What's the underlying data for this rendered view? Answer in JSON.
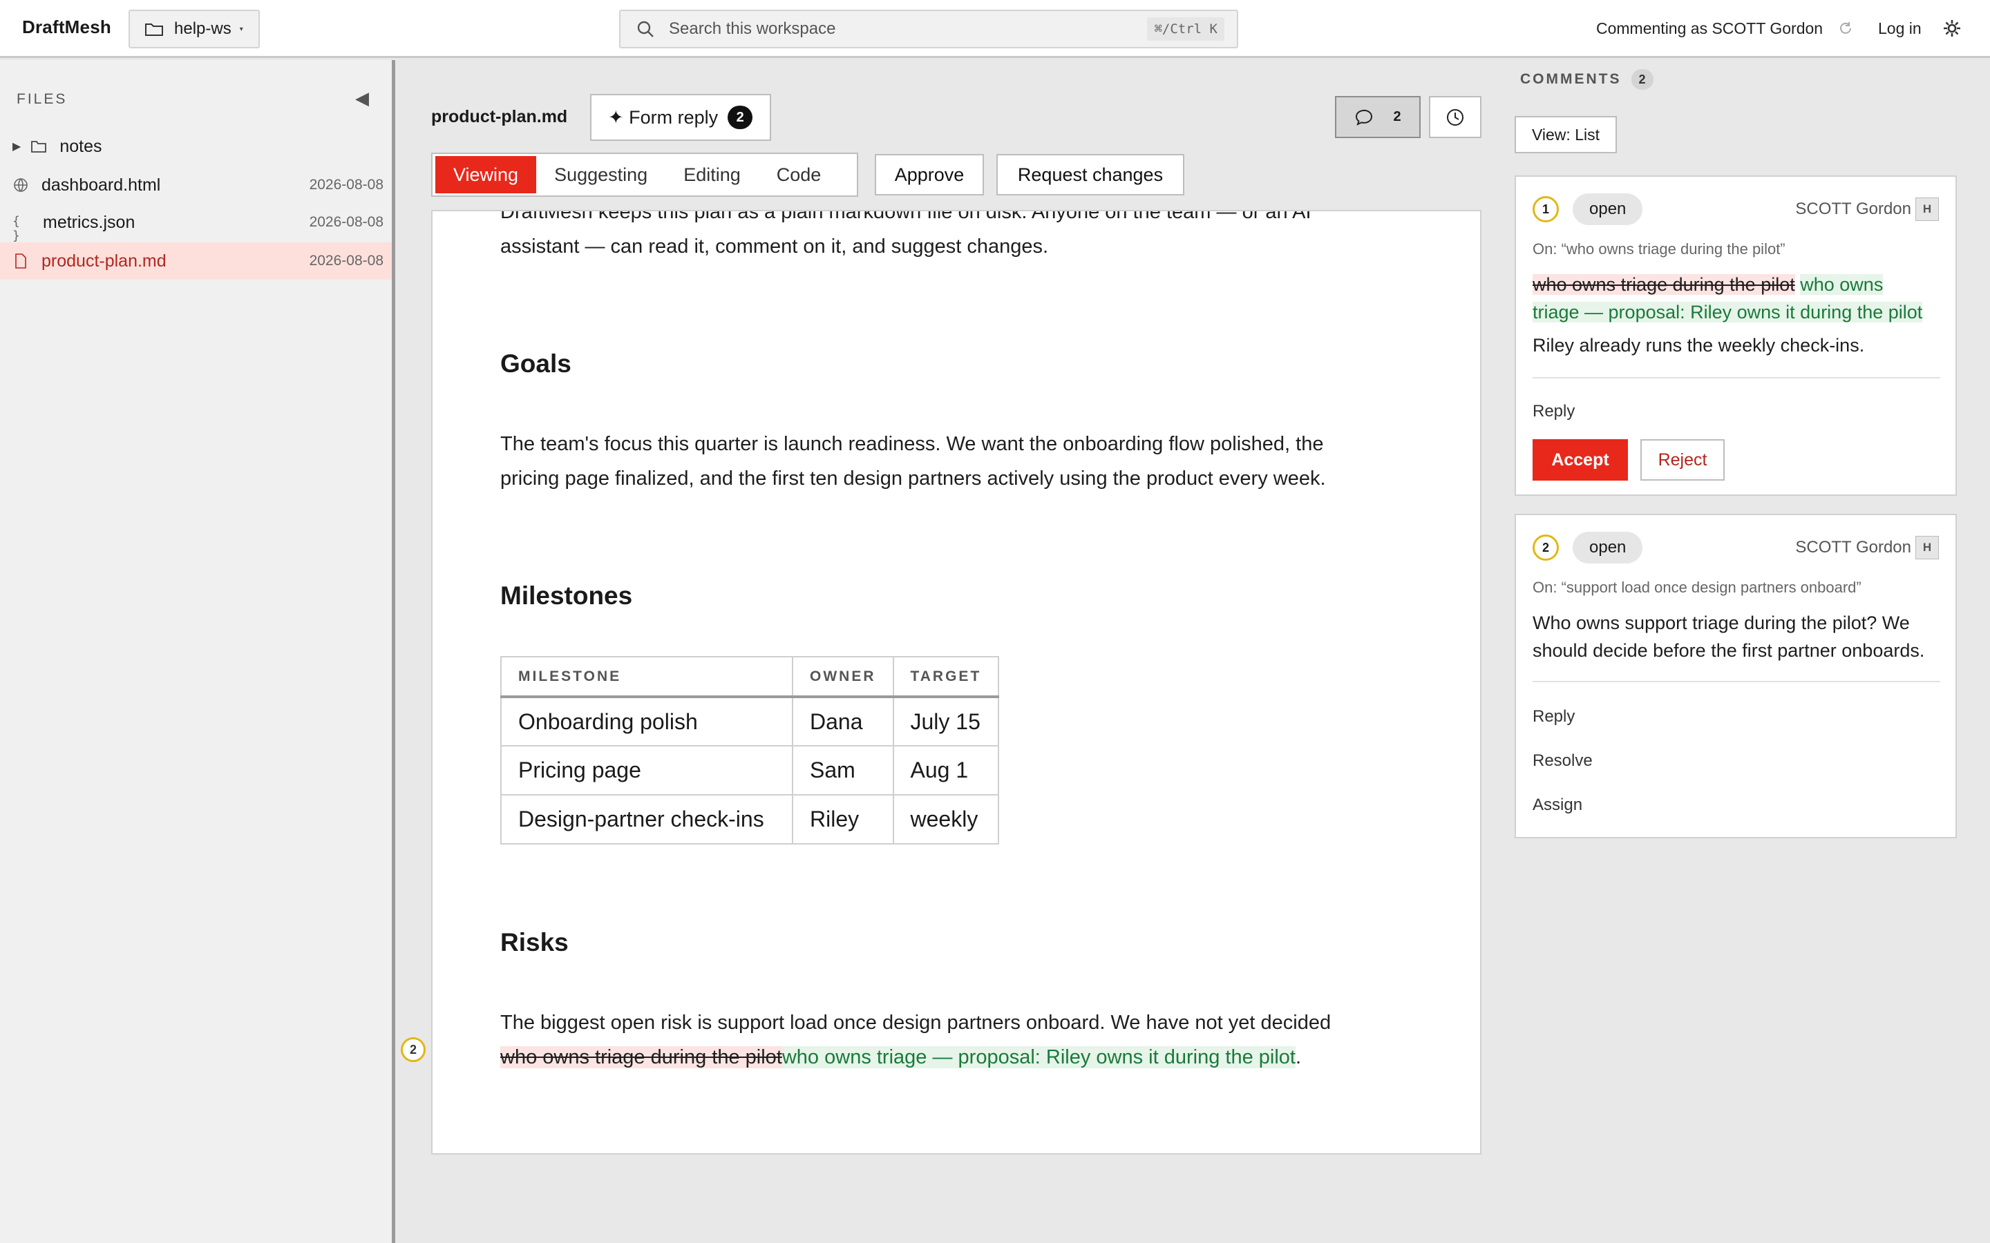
{
  "app": {
    "brand": "DraftMesh"
  },
  "workspace": {
    "name": "help-ws",
    "caret": "▾"
  },
  "search": {
    "placeholder": "Search this workspace",
    "shortcut": "⌘/Ctrl K"
  },
  "header": {
    "commenting_as": "Commenting as SCOTT Gordon",
    "login": "Log in"
  },
  "sidebar": {
    "label": "FILES",
    "collapse_glyph": "◀",
    "folder": {
      "name": "notes"
    },
    "files": [
      {
        "name": "dashboard.html",
        "date": "2026-08-08",
        "icon": "globe-icon"
      },
      {
        "name": "metrics.json",
        "date": "2026-08-08",
        "icon": "braces-icon",
        "glyph": "{ }"
      },
      {
        "name": "product-plan.md",
        "date": "2026-08-08",
        "icon": "file-icon",
        "active": true
      }
    ]
  },
  "editor": {
    "doc_title": "product-plan.md",
    "form_reply": {
      "label": "✦ Form reply",
      "count": "2"
    },
    "comments_count": "2",
    "modes": [
      "Viewing",
      "Suggesting",
      "Editing",
      "Code"
    ],
    "active_mode": "Viewing",
    "approve": "Approve",
    "request_changes": "Request changes"
  },
  "document": {
    "intro_line1": "DraftMesh keeps this plan as a plain markdown file on disk. Anyone on the team — or an AI",
    "intro_line2": "assistant — can read it, comment on it, and suggest changes.",
    "goals_heading": "Goals",
    "goals_line1": "The team's focus this quarter is launch readiness. We want the onboarding flow polished, the",
    "goals_line2": "pricing page finalized, and the first ten design partners actively using the product every week.",
    "milestones_heading": "Milestones",
    "table": {
      "headers": [
        "MILESTONE",
        "OWNER",
        "TARGET"
      ],
      "rows": [
        [
          "Onboarding polish",
          "Dana",
          "July 15"
        ],
        [
          "Pricing page",
          "Sam",
          "Aug 1"
        ],
        [
          "Design-partner check-ins",
          "Riley",
          "weekly"
        ]
      ]
    },
    "risks_heading": "Risks",
    "risks_line1": "The biggest open risk is support load once design partners onboard. We have not yet decided",
    "risks_deleted": "who owns triage during the pilot",
    "risks_inserted": "who owns triage — proposal: Riley owns it during the pilot",
    "risks_end": ".",
    "marker": "2"
  },
  "comments": {
    "heading": "COMMENTS",
    "count": "2",
    "view": "View: List",
    "items": [
      {
        "num": "1",
        "status": "open",
        "author": "SCOTT Gordon",
        "avatar": "H",
        "on": "On: “who owns triage during the pilot”",
        "deleted": "who owns triage during the pilot",
        "inserted_1": "who owns",
        "inserted_2": "triage — proposal: Riley owns it during the pilot",
        "note": "Riley already runs the weekly check-ins.",
        "reply": "Reply",
        "accept": "Accept",
        "reject": "Reject"
      },
      {
        "num": "2",
        "status": "open",
        "author": "SCOTT Gordon",
        "avatar": "H",
        "on": "On: “support load once design partners onboard”",
        "body_1": "Who owns support triage during the pilot? We",
        "body_2": "should decide before the first partner onboards.",
        "reply": "Reply",
        "resolve": "Resolve",
        "assign": "Assign"
      }
    ]
  },
  "colors": {
    "accent": "#e8281a",
    "inserted": "#1a7a3a",
    "deleted_bg": "#fbe4e2",
    "marker": "#e2b714"
  }
}
